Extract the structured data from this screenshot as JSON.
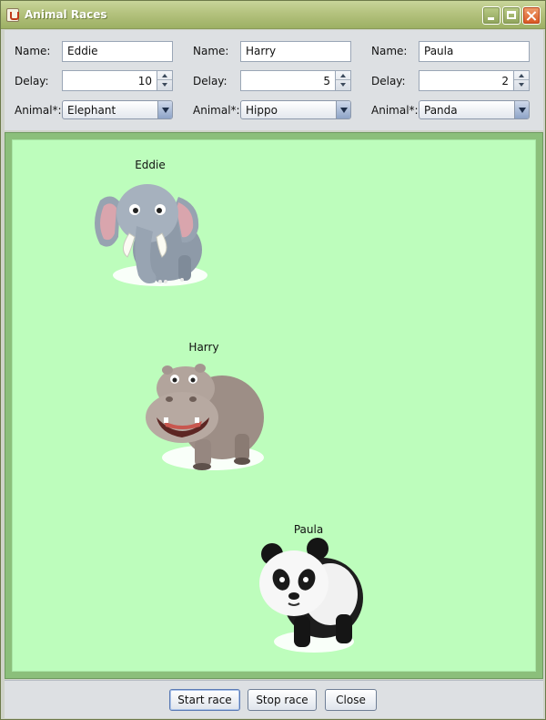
{
  "window": {
    "title": "Animal Races"
  },
  "racers": [
    {
      "name_label": "Name:",
      "name": "Eddie",
      "delay_label": "Delay:",
      "delay": "10",
      "animal_label": "Animal*:",
      "animal": "Elephant"
    },
    {
      "name_label": "Name:",
      "name": "Harry",
      "delay_label": "Delay:",
      "delay": "5",
      "animal_label": "Animal*:",
      "animal": "Hippo"
    },
    {
      "name_label": "Name:",
      "name": "Paula",
      "delay_label": "Delay:",
      "delay": "2",
      "animal_label": "Animal*:",
      "animal": "Panda"
    }
  ],
  "track": {
    "labels": [
      "Eddie",
      "Harry",
      "Paula"
    ],
    "background": "#bdfdbc"
  },
  "buttons": {
    "start": "Start race",
    "stop": "Stop race",
    "close": "Close"
  },
  "icons": {
    "app": "java-cup-icon",
    "minimize": "minimize-icon",
    "maximize": "maximize-icon",
    "close": "close-icon",
    "spin_up": "arrow-up-icon",
    "spin_down": "arrow-down-icon",
    "combo": "chevron-down-icon"
  }
}
